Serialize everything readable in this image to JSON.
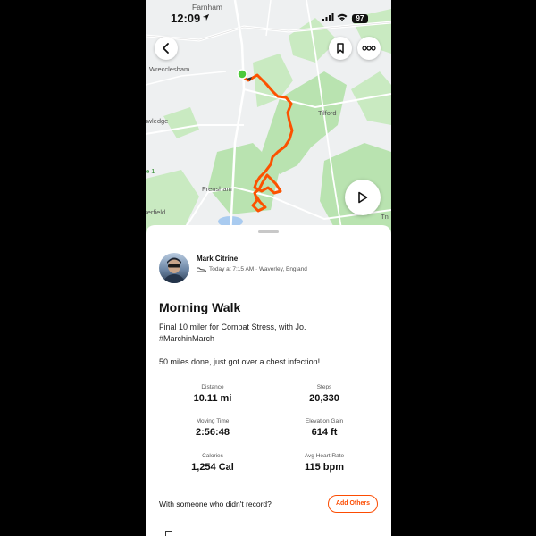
{
  "status_bar": {
    "time": "12:09",
    "battery": "97",
    "icons": [
      "location-arrow-icon",
      "signal-icon",
      "wifi-icon",
      "battery-icon"
    ]
  },
  "map": {
    "labels": {
      "farnham": "Farnham",
      "wrecclesham": "Wrecclesham",
      "tilford": "Tilford",
      "rowledge": "Rowledge",
      "frensham": "Frensham",
      "kerfield": "kerfield",
      "edge_left": "e 1",
      "edge_right": "Tn"
    },
    "route_color": "#fc5200",
    "start_color": "#4cc93a",
    "buttons": {
      "back": "chevron-left-icon",
      "save": "bookmark-icon",
      "more": "more-dots-icon",
      "play": "play-icon"
    }
  },
  "activity": {
    "athlete_name": "Mark Citrine",
    "meta": "Today at 7:15 AM · Waverley, England",
    "meta_icon": "shoe-icon",
    "title": "Morning Walk",
    "description_line1": "Final 10 miler for Combat Stress, with Jo.",
    "description_line2": "#MarchinMarch",
    "description_line3": "50 miles done, just got over a chest infection!",
    "stats": {
      "distance_label": "Distance",
      "distance_value": "10.11 mi",
      "steps_label": "Steps",
      "steps_value": "20,330",
      "moving_time_label": "Moving Time",
      "moving_time_value": "2:56:48",
      "elevation_label": "Elevation Gain",
      "elevation_value": "614 ft",
      "calories_label": "Calories",
      "calories_value": "1,254 Cal",
      "heart_rate_label": "Avg Heart Rate",
      "heart_rate_value": "115 bpm"
    },
    "others_text": "With someone who didn't record?",
    "add_others_label": "Add Others"
  },
  "colors": {
    "accent": "#fc4c02",
    "map_green": "#b9e3b0",
    "map_bg": "#eef0f1"
  }
}
